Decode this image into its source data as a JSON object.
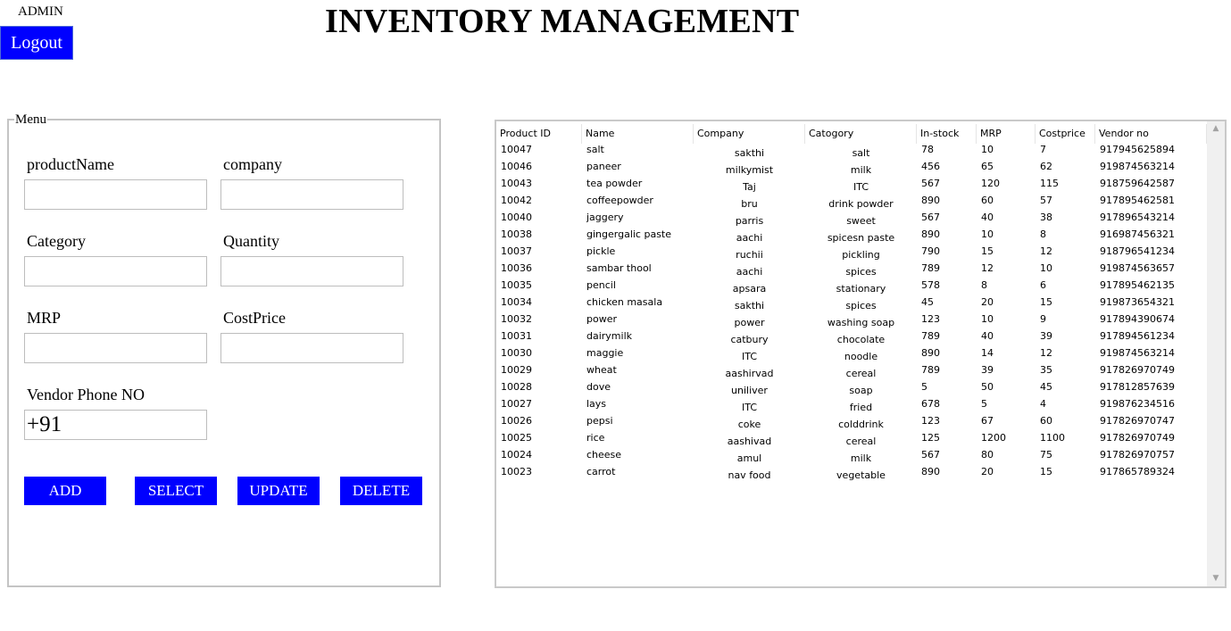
{
  "header": {
    "user_label": "ADMIN",
    "logout_label": "Logout",
    "title": "INVENTORY MANAGEMENT"
  },
  "menu": {
    "legend": "Menu",
    "fields": {
      "product_name": {
        "label": "productName",
        "value": ""
      },
      "company": {
        "label": "company",
        "value": ""
      },
      "category": {
        "label": "Category",
        "value": ""
      },
      "quantity": {
        "label": "Quantity",
        "value": ""
      },
      "mrp": {
        "label": "MRP",
        "value": ""
      },
      "cost_price": {
        "label": "CostPrice",
        "value": ""
      },
      "vendor_phone": {
        "label": "Vendor Phone NO",
        "value": "+91"
      }
    },
    "buttons": {
      "add": "ADD",
      "select": "SELECT",
      "update": "UPDATE",
      "delete": "DELETE"
    }
  },
  "table": {
    "columns": [
      "Product ID",
      "Name",
      "Company",
      "Catogory",
      "In-stock",
      "MRP",
      "Costprice",
      "Vendor no"
    ],
    "rows": [
      [
        "10047",
        "salt",
        "sakthi",
        "salt",
        "78",
        "10",
        "7",
        "917945625894"
      ],
      [
        "10046",
        "paneer",
        "milkymist",
        "milk",
        "456",
        "65",
        "62",
        "919874563214"
      ],
      [
        "10043",
        "tea powder",
        "Taj",
        "ITC",
        "567",
        "120",
        "115",
        "918759642587"
      ],
      [
        "10042",
        "coffeepowder",
        "bru",
        "drink powder",
        "890",
        "60",
        "57",
        "917895462581"
      ],
      [
        "10040",
        "jaggery",
        "parris",
        "sweet",
        "567",
        "40",
        "38",
        "917896543214"
      ],
      [
        "10038",
        "gingergalic paste",
        "aachi",
        "spicesn paste",
        "890",
        "10",
        "8",
        "916987456321"
      ],
      [
        "10037",
        "pickle",
        "ruchii",
        "pickling",
        "790",
        "15",
        "12",
        "918796541234"
      ],
      [
        "10036",
        "sambar thool",
        "aachi",
        "spices",
        "789",
        "12",
        "10",
        "919874563657"
      ],
      [
        "10035",
        "pencil",
        "apsara",
        "stationary",
        "578",
        "8",
        "6",
        "917895462135"
      ],
      [
        "10034",
        "chicken masala",
        "sakthi",
        "spices",
        "45",
        "20",
        "15",
        "919873654321"
      ],
      [
        "10032",
        "power",
        "power",
        "washing soap",
        "123",
        "10",
        "9",
        "917894390674"
      ],
      [
        "10031",
        "dairymilk",
        "catbury",
        "chocolate",
        "789",
        "40",
        "39",
        "917894561234"
      ],
      [
        "10030",
        "maggie",
        "ITC",
        "noodle",
        "890",
        "14",
        "12",
        "919874563214"
      ],
      [
        "10029",
        "wheat",
        "aashirvad",
        "cereal",
        "789",
        "39",
        "35",
        "917826970749"
      ],
      [
        "10028",
        "dove",
        "uniliver",
        "soap",
        "5",
        "50",
        "45",
        "917812857639"
      ],
      [
        "10027",
        "lays",
        "ITC",
        "fried",
        "678",
        "5",
        "4",
        "919876234516"
      ],
      [
        "10026",
        "pepsi",
        "coke",
        "colddrink",
        "123",
        "67",
        "60",
        "917826970747"
      ],
      [
        "10025",
        "rice",
        "aashivad",
        "cereal",
        "125",
        "1200",
        "1100",
        "917826970749"
      ],
      [
        "10024",
        "cheese",
        "amul",
        "milk",
        "567",
        "80",
        "75",
        "917826970757"
      ],
      [
        "10023",
        "carrot",
        "nav food",
        "vegetable",
        "890",
        "20",
        "15",
        "917865789324"
      ]
    ]
  },
  "scrollbar": {
    "up_icon": "scroll-up-arrow-icon",
    "down_icon": "scroll-down-arrow-icon"
  },
  "colors": {
    "button_blue": "#0000ff",
    "border_gray": "#c4c4c4"
  }
}
